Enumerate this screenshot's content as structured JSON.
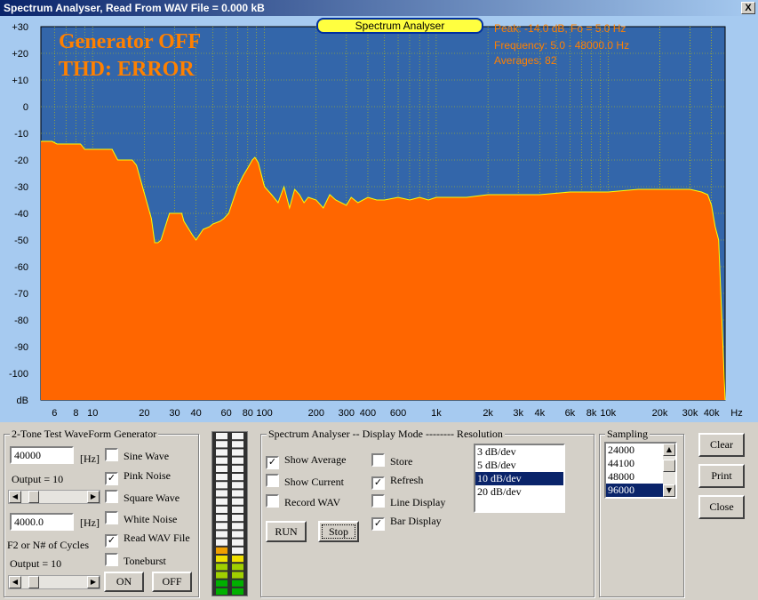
{
  "window": {
    "title": "Spectrum Analyser, Read From WAV File = 0.000 kB",
    "close_label": "X"
  },
  "chart": {
    "tab_label": "Spectrum Analyser",
    "overlay_line1": "Generator OFF",
    "overlay_line2": "THD: ERROR",
    "info_peak": "Peak: -14.0 dB, Fo = 5.0 Hz",
    "info_freq": "Frequency: 5.0 - 48000.0 Hz",
    "info_avg": "Averages: 82",
    "colors": {
      "plot_bg": "#3366aa",
      "fill": "#ff6600",
      "trace": "#ffff00",
      "grid": "#c8c800",
      "overlay_text": "#ff8000"
    }
  },
  "chart_data": {
    "type": "area",
    "ylabel": "dB",
    "xlabel": "Hz",
    "x_scale": "log",
    "xlim": [
      5,
      48000
    ],
    "ylim": [
      -110,
      30
    ],
    "y_ticks": [
      "+30",
      "+20",
      "+10",
      "0",
      "-10",
      "-20",
      "-30",
      "-40",
      "-50",
      "-60",
      "-70",
      "-80",
      "-90",
      "-100",
      "dB"
    ],
    "x_ticks": [
      {
        "v": 6,
        "label": "6"
      },
      {
        "v": 8,
        "label": "8"
      },
      {
        "v": 10,
        "label": "10"
      },
      {
        "v": 20,
        "label": "20"
      },
      {
        "v": 30,
        "label": "30"
      },
      {
        "v": 40,
        "label": "40"
      },
      {
        "v": 60,
        "label": "60"
      },
      {
        "v": 80,
        "label": "80"
      },
      {
        "v": 100,
        "label": "100"
      },
      {
        "v": 200,
        "label": "200"
      },
      {
        "v": 300,
        "label": "300"
      },
      {
        "v": 400,
        "label": "400"
      },
      {
        "v": 600,
        "label": "600"
      },
      {
        "v": 1000,
        "label": "1k"
      },
      {
        "v": 2000,
        "label": "2k"
      },
      {
        "v": 3000,
        "label": "3k"
      },
      {
        "v": 4000,
        "label": "4k"
      },
      {
        "v": 6000,
        "label": "6k"
      },
      {
        "v": 8000,
        "label": "8k"
      },
      {
        "v": 10000,
        "label": "10k"
      },
      {
        "v": 20000,
        "label": "20k"
      },
      {
        "v": 30000,
        "label": "30k"
      },
      {
        "v": 40000,
        "label": "40k"
      }
    ],
    "series": [
      {
        "x": [
          5,
          5.8,
          6.2,
          8.5,
          9,
          13,
          14,
          17,
          18,
          22,
          23,
          24,
          25,
          28,
          33,
          34,
          38,
          40,
          44,
          48,
          50,
          55,
          58,
          62,
          65,
          70,
          75,
          80,
          85,
          88,
          92,
          100,
          110,
          120,
          130,
          140,
          150,
          160,
          170,
          180,
          200,
          220,
          240,
          260,
          300,
          320,
          350,
          400,
          450,
          500,
          600,
          700,
          800,
          900,
          1000,
          1500,
          2000,
          3000,
          4000,
          6000,
          8000,
          10000,
          15000,
          20000,
          25000,
          30000,
          35000,
          38000,
          40000,
          42000,
          44000,
          46000,
          48000
        ],
        "y": [
          -13,
          -13,
          -14,
          -14,
          -16,
          -16,
          -20,
          -20,
          -22,
          -42,
          -51,
          -51,
          -50,
          -40,
          -40,
          -43,
          -48,
          -50,
          -46,
          -45,
          -44,
          -43,
          -42,
          -40,
          -36,
          -30,
          -26,
          -23,
          -20,
          -19,
          -21,
          -30,
          -33,
          -36,
          -30,
          -38,
          -31,
          -33,
          -36,
          -34,
          -35,
          -38,
          -33,
          -35,
          -37,
          -34,
          -36,
          -34,
          -35,
          -35,
          -34,
          -35,
          -34,
          -35,
          -34,
          -34,
          -33,
          -33,
          -33,
          -32,
          -32,
          -32,
          -31,
          -31,
          -31,
          -31,
          -32,
          -33,
          -37,
          -45,
          -50,
          -80,
          -110
        ]
      }
    ]
  },
  "generator": {
    "title": "2-Tone Test WaveForm Generator",
    "freq1_value": "40000",
    "freq2_value": "4000.0",
    "hz_label": "[Hz]",
    "output1_label": "Output = 10",
    "f2_label": "F2 or N# of Cycles",
    "output2_label": "Output = 10",
    "checks": [
      {
        "label": "Sine Wave",
        "checked": false
      },
      {
        "label": "Pink Noise",
        "checked": true
      },
      {
        "label": "Square Wave",
        "checked": false
      },
      {
        "label": "White Noise",
        "checked": false
      },
      {
        "label": "Read WAV File",
        "checked": true
      },
      {
        "label": "Toneburst",
        "checked": false
      }
    ],
    "on_label": "ON",
    "off_label": "OFF"
  },
  "display_mode": {
    "title": "Spectrum Analyser -- Display Mode -------- Resolution",
    "checks_left": [
      {
        "label": "Show Average",
        "checked": true
      },
      {
        "label": "Show Current",
        "checked": false
      },
      {
        "label": "Record WAV",
        "checked": false
      }
    ],
    "checks_right": [
      {
        "label": "Store",
        "checked": false
      },
      {
        "label": "Refresh",
        "checked": true
      },
      {
        "label": "Line Display",
        "checked": false
      },
      {
        "label": "Bar Display",
        "checked": true
      }
    ],
    "run_label": "RUN",
    "stop_label": "Stop",
    "resolution_options": [
      "3 dB/dev",
      "5 dB/dev",
      "10 dB/dev",
      "20 dB/dev"
    ],
    "resolution_selected": "10 dB/dev"
  },
  "sampling": {
    "title": "Sampling",
    "options": [
      "24000",
      "44100",
      "48000",
      "96000"
    ],
    "selected": "96000"
  },
  "buttons": {
    "clear": "Clear",
    "print": "Print",
    "close": "Close"
  },
  "meter": {
    "left_level_segments": 6,
    "right_level_segments": 5,
    "total_segments": 20
  }
}
